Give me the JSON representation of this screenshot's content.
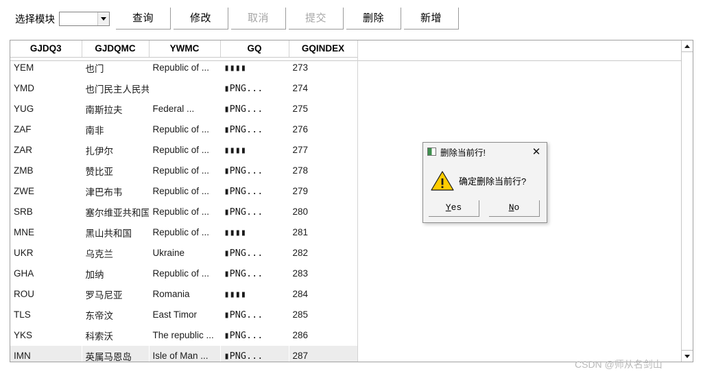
{
  "toolbar": {
    "module_label": "选择模块",
    "module_select": {
      "value": "",
      "placeholder": ""
    },
    "buttons": [
      {
        "label": "查询",
        "name": "query-button",
        "disabled": false
      },
      {
        "label": "修改",
        "name": "modify-button",
        "disabled": false
      },
      {
        "label": "取消",
        "name": "cancel-button",
        "disabled": true
      },
      {
        "label": "提交",
        "name": "submit-button",
        "disabled": true
      },
      {
        "label": "删除",
        "name": "delete-button",
        "disabled": false
      },
      {
        "label": "新增",
        "name": "add-button",
        "disabled": false
      }
    ]
  },
  "grid": {
    "columns": [
      "GJDQ3",
      "GJDQMC",
      "YWMC",
      "GQ",
      "GQINDEX"
    ],
    "selected_row_index": 14,
    "rows": [
      {
        "GJDQ3": "YEM",
        "GJDQMC": "也门",
        "YWMC": "Republic of ...",
        "GQ": "▮▮▮▮",
        "GQINDEX": "273"
      },
      {
        "GJDQ3": "YMD",
        "GJDQMC": "也门民主人民共...",
        "YWMC": "",
        "GQ": "▮PNG...",
        "GQINDEX": "274"
      },
      {
        "GJDQ3": "YUG",
        "GJDQMC": "南斯拉夫",
        "YWMC": "Federal ...",
        "GQ": "▮PNG...",
        "GQINDEX": "275"
      },
      {
        "GJDQ3": "ZAF",
        "GJDQMC": "南非",
        "YWMC": "Republic of ...",
        "GQ": "▮PNG...",
        "GQINDEX": "276"
      },
      {
        "GJDQ3": "ZAR",
        "GJDQMC": "扎伊尔",
        "YWMC": "Republic of ...",
        "GQ": "▮▮▮▮",
        "GQINDEX": "277"
      },
      {
        "GJDQ3": "ZMB",
        "GJDQMC": "赞比亚",
        "YWMC": "Republic of ...",
        "GQ": "▮PNG...",
        "GQINDEX": "278"
      },
      {
        "GJDQ3": "ZWE",
        "GJDQMC": "津巴布韦",
        "YWMC": "Republic of ...",
        "GQ": "▮PNG...",
        "GQINDEX": "279"
      },
      {
        "GJDQ3": "SRB",
        "GJDQMC": "塞尔维亚共和国",
        "YWMC": "Republic of ...",
        "GQ": "▮PNG...",
        "GQINDEX": "280"
      },
      {
        "GJDQ3": "MNE",
        "GJDQMC": "黑山共和国",
        "YWMC": "Republic of ...",
        "GQ": "▮▮▮▮",
        "GQINDEX": "281"
      },
      {
        "GJDQ3": "UKR",
        "GJDQMC": "乌克兰",
        "YWMC": "Ukraine",
        "GQ": "▮PNG...",
        "GQINDEX": "282"
      },
      {
        "GJDQ3": "GHA",
        "GJDQMC": "加纳",
        "YWMC": "Republic of ...",
        "GQ": "▮PNG...",
        "GQINDEX": "283"
      },
      {
        "GJDQ3": "ROU",
        "GJDQMC": "罗马尼亚",
        "YWMC": "Romania",
        "GQ": "▮▮▮▮",
        "GQINDEX": "284"
      },
      {
        "GJDQ3": "TLS",
        "GJDQMC": "东帝汶",
        "YWMC": "East Timor",
        "GQ": "▮PNG...",
        "GQINDEX": "285"
      },
      {
        "GJDQ3": "YKS",
        "GJDQMC": "科索沃",
        "YWMC": "The  republic ...",
        "GQ": "▮PNG...",
        "GQINDEX": "286"
      },
      {
        "GJDQ3": "IMN",
        "GJDQMC": "英属马恩岛",
        "YWMC": "Isle of Man ...",
        "GQ": "▮PNG...",
        "GQINDEX": "287"
      }
    ]
  },
  "scrollbar": {
    "up_arrow": "scroll-up-arrow",
    "down_arrow": "scroll-down-arrow"
  },
  "dialog": {
    "title": "删除当前行!",
    "close_label": "✕",
    "message": "确定删除当前行?",
    "warning_icon": "warning-triangle-icon",
    "buttons": [
      {
        "name": "yes-button",
        "accel": "Y",
        "rest": "es"
      },
      {
        "name": "no-button",
        "accel": "N",
        "rest": "o"
      }
    ],
    "colors": {
      "warning": "#ffcc00",
      "title_icon": "#3f8f4e"
    }
  },
  "watermark": {
    "text": "CSDN @师从名剑山"
  }
}
